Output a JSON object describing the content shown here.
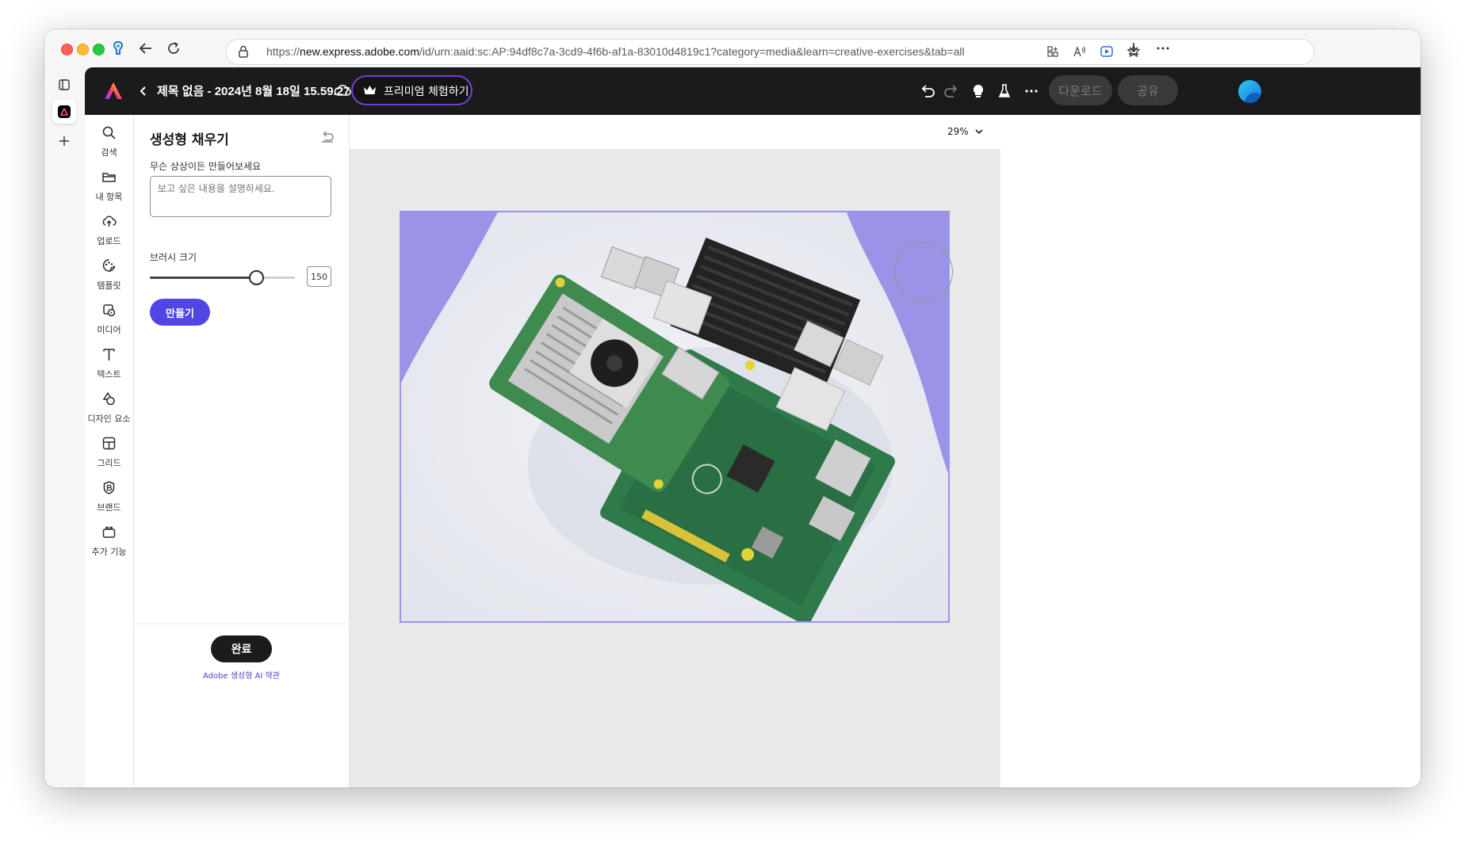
{
  "browser": {
    "url_scheme": "https://",
    "url_host": "new.express.adobe.com",
    "url_path": "/id/urn:aaid:sc:AP:94df8c7a-3cd9-4f6b-af1a-83010d4819c1?category=media&learn=creative-exercises&tab=all"
  },
  "header": {
    "doc_title": "제목 없음 - 2024년 8월 18일 15.59.27",
    "premium_label": "프리미엄 체험하기",
    "download_label": "다운로드",
    "share_label": "공유"
  },
  "rail": {
    "items": [
      {
        "label": "검색",
        "icon": "search-icon"
      },
      {
        "label": "내 항목",
        "icon": "folder-icon"
      },
      {
        "label": "업로드",
        "icon": "upload-cloud-icon"
      },
      {
        "label": "템플릿",
        "icon": "template-icon"
      },
      {
        "label": "미디어",
        "icon": "media-icon"
      },
      {
        "label": "텍스트",
        "icon": "text-icon"
      },
      {
        "label": "디자인 요소",
        "icon": "shapes-icon"
      },
      {
        "label": "그리드",
        "icon": "grid-icon"
      },
      {
        "label": "브랜드",
        "icon": "brand-icon"
      },
      {
        "label": "추가 기능",
        "icon": "addons-icon"
      }
    ]
  },
  "panel": {
    "title": "생성형 채우기",
    "prompt_label": "무슨 상상이든 만들어보세요",
    "prompt_placeholder": "보고 싶은 내용을 설명하세요.",
    "brush_label": "브러시 크기",
    "brush_value": "150",
    "brush_fraction": 0.73,
    "generate_label": "만들기",
    "done_label": "완료",
    "terms_link": "Adobe 생성형 AI 약관"
  },
  "canvas": {
    "zoom": "29%"
  },
  "colors": {
    "accent": "#5046e4",
    "topbar": "#1b1b1b",
    "selection_border": "#9c92ea",
    "mask_purple": "#9a93e6"
  }
}
